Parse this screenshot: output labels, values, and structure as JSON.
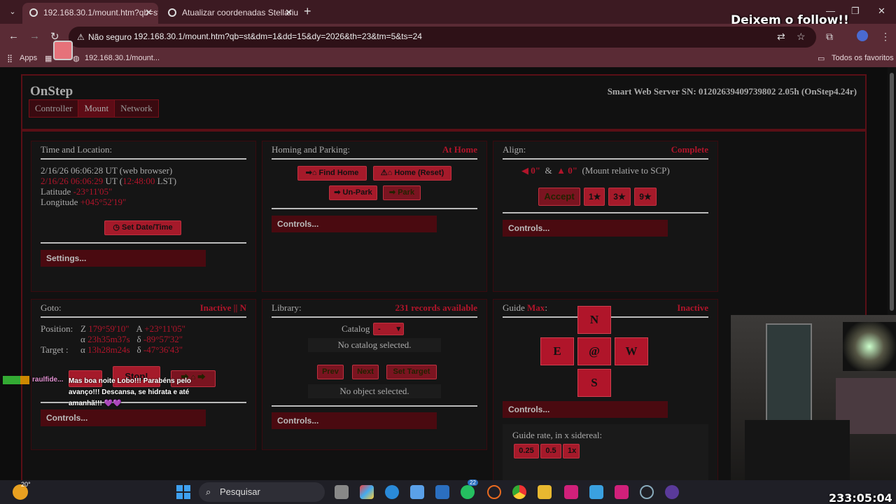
{
  "browser": {
    "tabs": [
      {
        "title": "192.168.30.1/mount.htm?qb=st",
        "active": true
      },
      {
        "title": "Atualizar coordenadas Stellariu",
        "active": false
      }
    ],
    "not_secure_label": "Não seguro",
    "url": "192.168.30.1/mount.htm?qb=st&dm=1&dd=15&dy=2026&th=23&tm=5&ts=24",
    "bookmarks": {
      "apps": "Apps",
      "item": "192.168.30.1/mount...",
      "all": "Todos os favoritos"
    }
  },
  "overlay": {
    "follow_text": "Deixem o follow!!",
    "chat_user": "raulfide...",
    "chat_message": "Mas boa noite Lobo!!! Parabéns pelo avanço!!! Descansa, se hidrata e até amanhã!!! 💜💜",
    "timer": "233:05:04"
  },
  "header": {
    "brand": "OnStep",
    "serial": "Smart Web Server SN: 01202639409739802 2.05h (OnStep4.24r)",
    "nav": [
      "Controller",
      "Mount",
      "Network"
    ]
  },
  "time_location": {
    "title": "Time and Location:",
    "browser_time": "2/16/26 06:06:28 UT (web browser)",
    "mount_time": "2/16/26 06:06:29",
    "ut_label": "UT (",
    "lst": "12:48:00",
    "lst_label": "LST)",
    "latitude_label": "Latitude",
    "latitude": "-23°11'05\"",
    "longitude_label": "Longitude",
    "longitude": "+045°52'19\"",
    "set_button": "Set Date/Time",
    "settings": "Settings..."
  },
  "homing": {
    "title": "Homing and Parking:",
    "status": "At Home",
    "find_home": "Find Home",
    "home_reset": "Home (Reset)",
    "unpark": "Un-Park",
    "park": "Park",
    "controls": "Controls..."
  },
  "align": {
    "title": "Align:",
    "status": "Complete",
    "az_err": "0\"",
    "amp": "&",
    "alt_err": "0\"",
    "note": "(Mount relative to SCP)",
    "accept": "Accept",
    "one_star": "1★",
    "three_star": "3★",
    "nine_star": "9★",
    "controls": "Controls..."
  },
  "goto": {
    "title": "Goto:",
    "status": "Inactive || N",
    "position_label": "Position:",
    "pos_z_label": "Z",
    "pos_z": "179°59'10\"",
    "pos_a_label": "A",
    "pos_a": "+23°11'05\"",
    "pos_ra_label": "α",
    "pos_ra": "23h35m37s",
    "pos_dec_label": "δ",
    "pos_dec": "-89°57'32\"",
    "target_label": "Target :",
    "tgt_ra_label": "α",
    "tgt_ra": "13h28m24s",
    "tgt_dec_label": "δ",
    "tgt_dec": "-47°36'43\"",
    "stop": "Stop!",
    "controls": "Controls..."
  },
  "library": {
    "title": "Library:",
    "status": "231 records available",
    "catalog_label": "Catalog",
    "catalog_value": "-",
    "no_catalog": "No catalog selected.",
    "prev": "Prev",
    "next": "Next",
    "set_target": "Set Target",
    "no_object": "No object selected.",
    "controls": "Controls..."
  },
  "guide": {
    "title": "Guide",
    "title_rate": "Max",
    "title_colon": ":",
    "status": "Inactive",
    "n": "N",
    "e": "E",
    "sync": "@",
    "w": "W",
    "s": "S",
    "controls": "Controls...",
    "rate_label": "Guide rate, in x sidereal:",
    "rates": [
      "0.25",
      "0.5",
      "1x"
    ]
  },
  "taskbar": {
    "temperature": "20°",
    "search_placeholder": "Pesquisar",
    "whatsapp_badge": "22"
  }
}
